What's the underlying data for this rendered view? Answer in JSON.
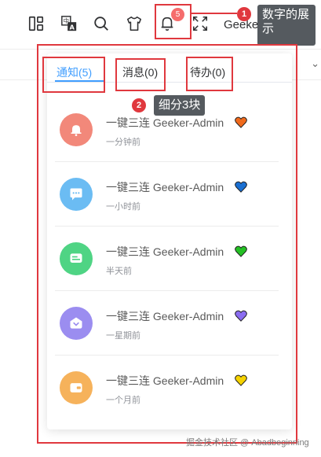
{
  "header": {
    "icons": [
      "layout-icon",
      "translate-icon",
      "search-icon",
      "theme-shirt-icon",
      "bell-icon",
      "fullscreen-icon"
    ],
    "notification_count": "5",
    "username": "Geeker"
  },
  "annotations": {
    "one": {
      "number": "1",
      "label_line1": "数字的展",
      "label_line2": "示"
    },
    "two": {
      "number": "2",
      "label": "细分3块"
    }
  },
  "dropdown": {
    "tabs": [
      {
        "label": "通知(5)",
        "active": true
      },
      {
        "label": "消息(0)",
        "active": false
      },
      {
        "label": "待办(0)",
        "active": false
      }
    ],
    "items": [
      {
        "title": "一键三连 Geeker-Admin",
        "time": "一分钟前",
        "icon_color": "#f2887a",
        "heart_color": "#f06a1c",
        "icon": "bell-icon"
      },
      {
        "title": "一键三连 Geeker-Admin",
        "time": "一小时前",
        "icon_color": "#6bbcf3",
        "heart_color": "#1a6fd1",
        "icon": "chat-bubble-icon"
      },
      {
        "title": "一键三连 Geeker-Admin",
        "time": "半天前",
        "icon_color": "#4fd484",
        "heart_color": "#24c024",
        "icon": "message-icon"
      },
      {
        "title": "一键三连 Geeker-Admin",
        "time": "一星期前",
        "icon_color": "#9b8df0",
        "heart_color": "#8a6cf0",
        "icon": "heart-chat-icon"
      },
      {
        "title": "一键三连 Geeker-Admin",
        "time": "一个月前",
        "icon_color": "#f6b25b",
        "heart_color": "#f5d200",
        "icon": "wallet-icon"
      }
    ]
  },
  "watermark": "掘金技术社区 @ Abadbeginning"
}
